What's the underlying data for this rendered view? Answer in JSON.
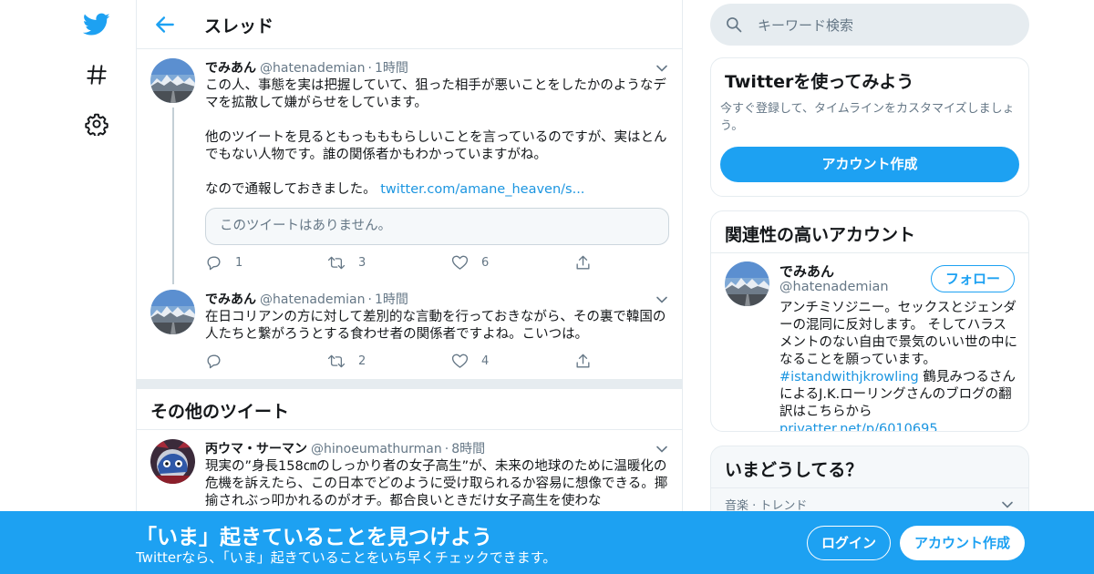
{
  "nav": {
    "logo_icon": "twitter-bird-icon",
    "explore_icon": "hashtag-icon",
    "settings_icon": "gear-icon"
  },
  "thread": {
    "title": "スレッド",
    "tweets": [
      {
        "name": "でみあん",
        "handle": "@hatenademian",
        "dot": "·",
        "time": "1時間",
        "paragraphs": [
          "この人、事態を実は把握していて、狙った相手が悪いことをしたかのようなデマを拡散して嫌がらせをしています。",
          "他のツイートを見るともっもももらしいことを言っているのですが、実はとんでもない人物です。誰の関係者かもわかっていますがね。",
          "なので通報しておきました。"
        ],
        "link": "twitter.com/amane_heaven/s...",
        "quote": "このツイートはありません。",
        "replies": "1",
        "retweets": "3",
        "likes": "6"
      },
      {
        "name": "でみあん",
        "handle": "@hatenademian",
        "dot": "·",
        "time": "1時間",
        "text": "在日コリアンの方に対して差別的な言動を行っておきながら、その裏で韓国の人たちと繋がろうとする食わせ者の関係者ですよね。こいつは。",
        "replies": "",
        "retweets": "2",
        "likes": "4"
      }
    ]
  },
  "other": {
    "title": "その他のツイート",
    "tweet": {
      "name": "丙ウマ・サーマン",
      "handle": "@hinoeumathurman",
      "dot": "·",
      "time": "8時間",
      "text": "現実の”身長158㎝のしっかり者の女子高生”が、未来の地球のために温暖化の危機を訴えたら、この日本でどのように受け取られるか容易に想像できる。揶揄されぶっ叩かれるのがオチ。都合良いときだけ女子高生を使わな"
    }
  },
  "search": {
    "placeholder": "キーワード検索"
  },
  "signup_card": {
    "title": "Twitterを使ってみよう",
    "subtitle": "今すぐ登録して、タイムラインをカスタマイズしましょう。",
    "button": "アカウント作成"
  },
  "related": {
    "title": "関連性の高いアカウント",
    "name": "でみあん",
    "handle": "@hatenademian",
    "follow": "フォロー",
    "bio": "アンチミソジニー。セックスとジェンダーの混同に反対します。 そしてハラスメントのない自由で景気のいい世の中になることを願っています。",
    "hashtag": "#istandwithjkrowling",
    "bio2": " 鶴見みつるさんによるJ.K.ローリングさんのブログの翻訳はこちらから ",
    "bio_link": "privatter.net/p/6010695"
  },
  "trends": {
    "title": "いまどうしてる？",
    "first_label": "音楽 · トレンド"
  },
  "banner": {
    "title": "「いま」起きていることを見つけよう",
    "subtitle": "Twitterなら、「いま」起きていることをいち早くチェックできます。",
    "login": "ログイン",
    "signup": "アカウント作成"
  },
  "colors": {
    "brand_blue": "#1da1f2",
    "link_blue": "#1b95e0",
    "muted_gray": "#657786",
    "border": "#e6ecf0"
  }
}
